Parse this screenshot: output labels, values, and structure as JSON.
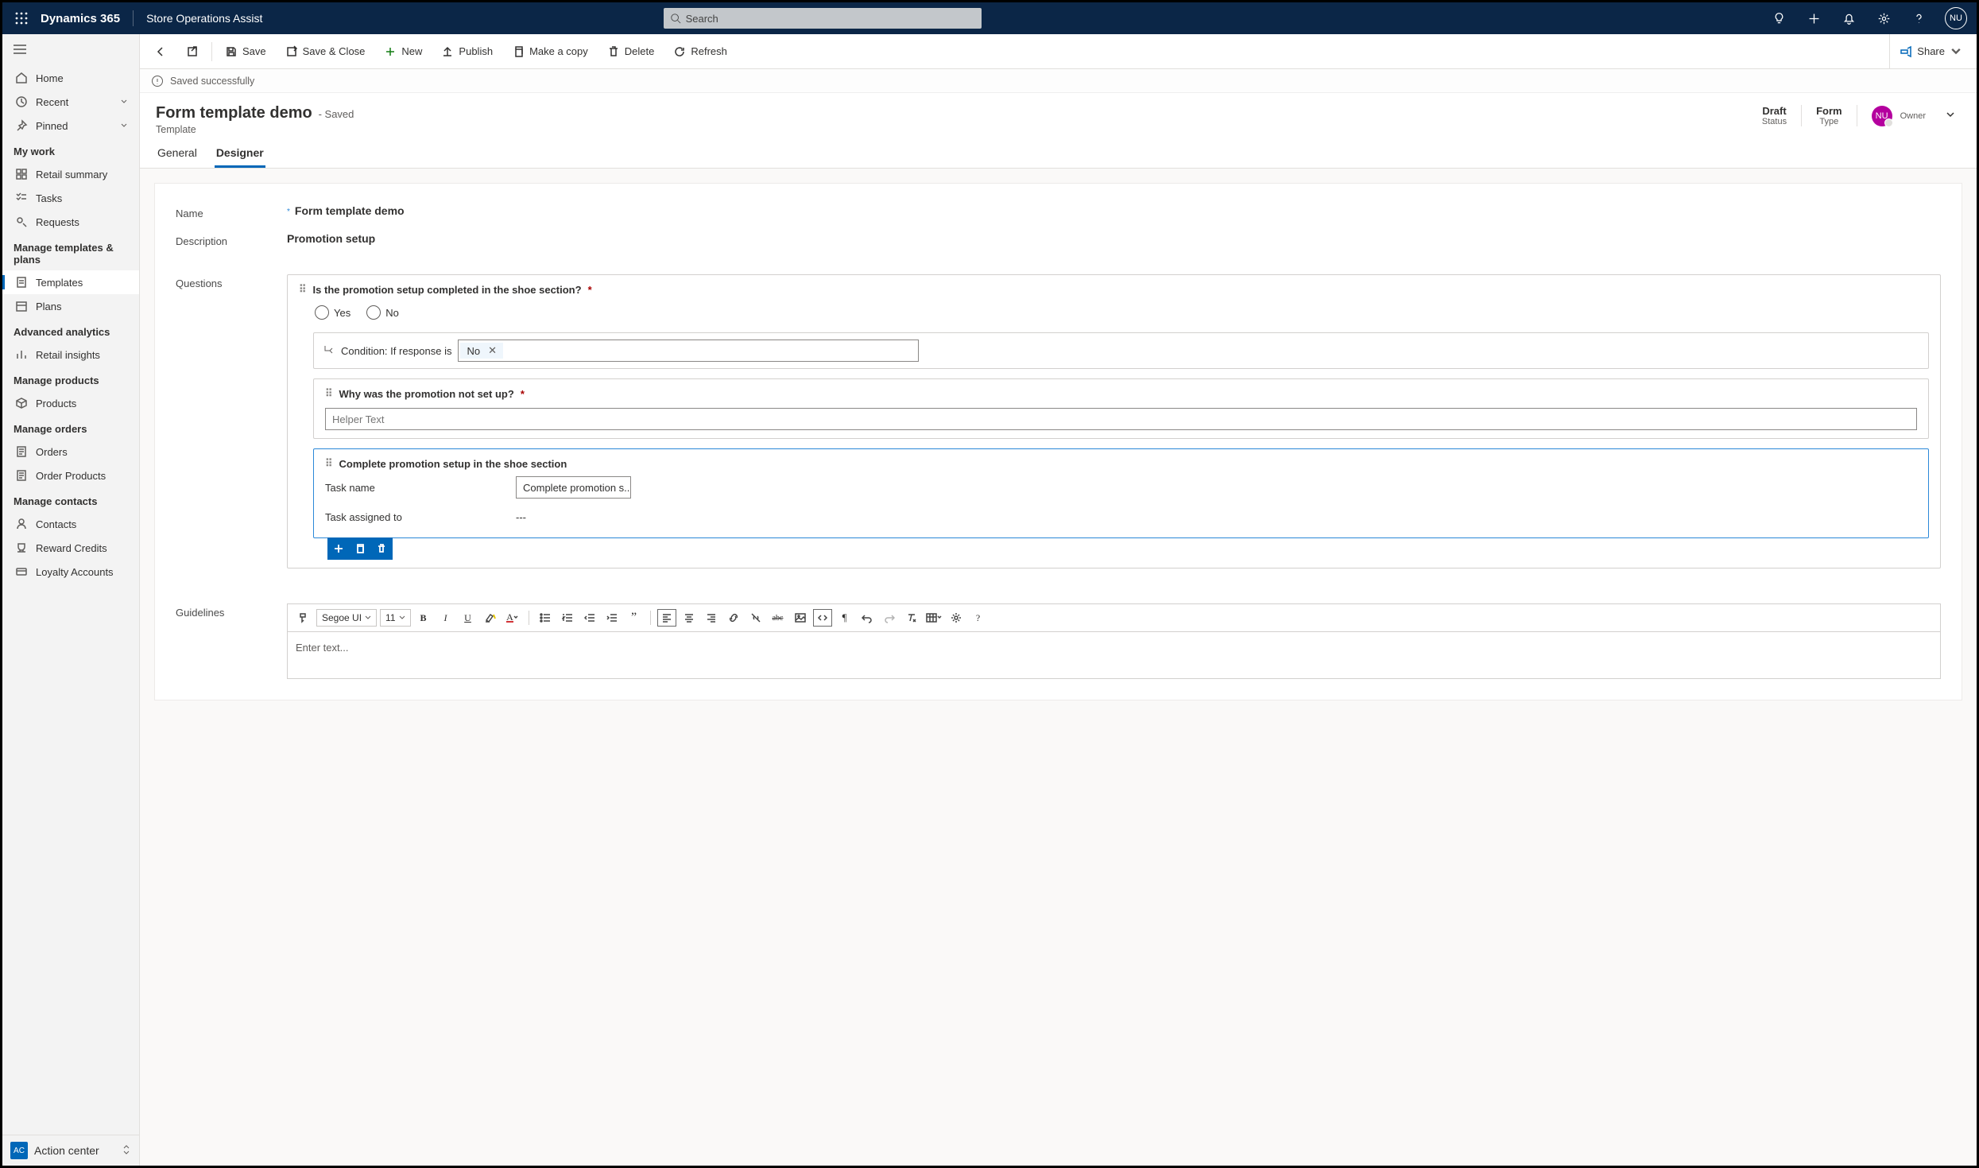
{
  "topbar": {
    "brand": "Dynamics 365",
    "app": "Store Operations Assist",
    "search_placeholder": "Search",
    "avatar": "NU"
  },
  "sidebar": {
    "top": [
      {
        "label": "Home"
      },
      {
        "label": "Recent",
        "chev": true
      },
      {
        "label": "Pinned",
        "chev": true
      }
    ],
    "groups": [
      {
        "title": "My work",
        "items": [
          {
            "label": "Retail summary"
          },
          {
            "label": "Tasks"
          },
          {
            "label": "Requests"
          }
        ]
      },
      {
        "title": "Manage templates & plans",
        "items": [
          {
            "label": "Templates",
            "active": true
          },
          {
            "label": "Plans"
          }
        ]
      },
      {
        "title": "Advanced analytics",
        "items": [
          {
            "label": "Retail insights"
          }
        ]
      },
      {
        "title": "Manage products",
        "items": [
          {
            "label": "Products"
          }
        ]
      },
      {
        "title": "Manage orders",
        "items": [
          {
            "label": "Orders"
          },
          {
            "label": "Order Products"
          }
        ]
      },
      {
        "title": "Manage contacts",
        "items": [
          {
            "label": "Contacts"
          },
          {
            "label": "Reward Credits"
          },
          {
            "label": "Loyalty Accounts"
          }
        ]
      }
    ],
    "action_center": {
      "badge": "AC",
      "label": "Action center"
    }
  },
  "cmdbar": {
    "save": "Save",
    "save_close": "Save & Close",
    "new": "New",
    "publish": "Publish",
    "copy": "Make a copy",
    "delete": "Delete",
    "refresh": "Refresh",
    "share": "Share"
  },
  "notice": "Saved successfully",
  "header": {
    "title": "Form template demo",
    "saved": "- Saved",
    "subtitle": "Template",
    "meta": [
      {
        "top": "Draft",
        "bot": "Status"
      },
      {
        "top": "Form",
        "bot": "Type"
      }
    ],
    "owner_initials": "NU",
    "owner_label": "Owner"
  },
  "tabs": {
    "general": "General",
    "designer": "Designer"
  },
  "form": {
    "name_lbl": "Name",
    "name_val": "Form template demo",
    "desc_lbl": "Description",
    "desc_val": "Promotion setup",
    "questions_lbl": "Questions",
    "q1": {
      "text": "Is the promotion setup completed in the shoe section?",
      "yes": "Yes",
      "no": "No"
    },
    "cond": {
      "label": "Condition: If response is",
      "value": "No"
    },
    "q2": {
      "text": "Why was the promotion not set up?",
      "helper_placeholder": "Helper Text"
    },
    "task": {
      "title": "Complete promotion setup in the shoe section",
      "name_lbl": "Task name",
      "name_val": "Complete promotion s...",
      "assign_lbl": "Task assigned to",
      "assign_val": "---"
    },
    "guidelines_lbl": "Guidelines",
    "rte": {
      "font": "Segoe UI",
      "size": "11",
      "placeholder": "Enter text..."
    }
  }
}
